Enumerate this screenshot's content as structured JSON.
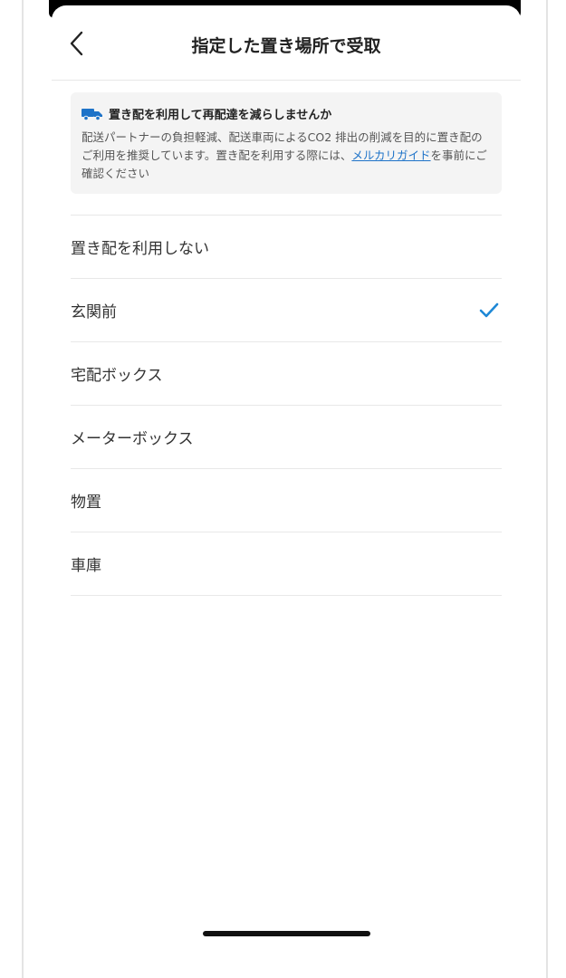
{
  "header": {
    "title": "指定した置き場所で受取"
  },
  "notice": {
    "heading": "置き配を利用して再配達を減らしませんか",
    "body_before_link": "配送パートナーの負担軽減、配送車両によるCO2 排出の削減を目的に置き配のご利用を推奨しています。置き配を利用する際には、",
    "link": "メルカリガイド",
    "body_after_link": "を事前にご確認ください"
  },
  "options": [
    {
      "label": "置き配を利用しない",
      "selected": false
    },
    {
      "label": "玄関前",
      "selected": true
    },
    {
      "label": "宅配ボックス",
      "selected": false
    },
    {
      "label": "メーターボックス",
      "selected": false
    },
    {
      "label": "物置",
      "selected": false
    },
    {
      "label": "車庫",
      "selected": false
    }
  ],
  "colors": {
    "accent": "#1e73c8",
    "check": "#1e88d6"
  }
}
